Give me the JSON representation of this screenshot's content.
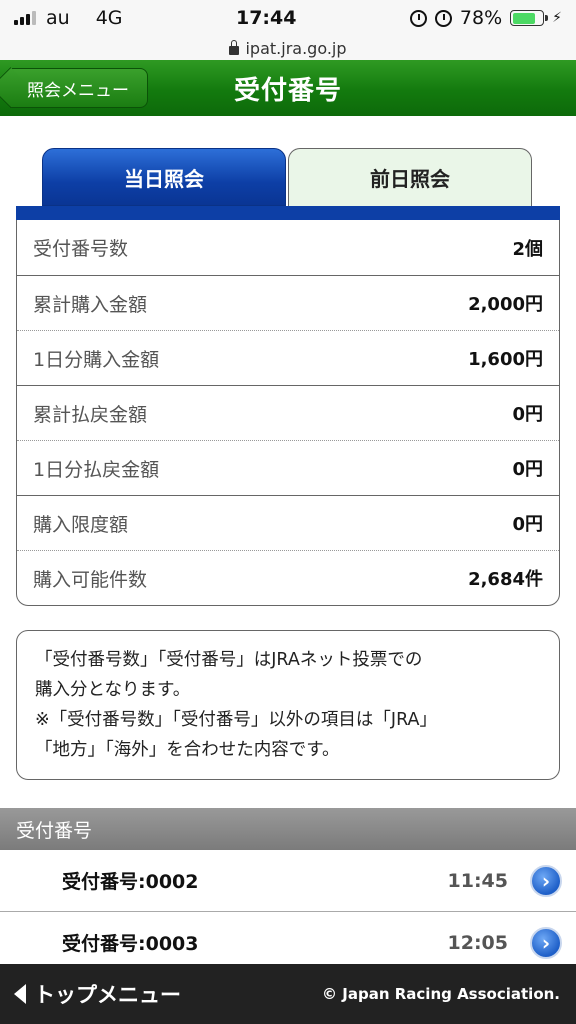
{
  "status_bar": {
    "carrier": "au",
    "network": "4G",
    "time": "17:44",
    "battery_percent": "78%",
    "battery_level": 0.78
  },
  "url": "ipat.jra.go.jp",
  "header": {
    "back_label": "照会メニュー",
    "title": "受付番号"
  },
  "tabs": [
    {
      "label": "当日照会",
      "active": true
    },
    {
      "label": "前日照会",
      "active": false
    }
  ],
  "summary": [
    {
      "label": "受付番号数",
      "value": "2個"
    },
    {
      "label": "累計購入金額",
      "value": "2,000円"
    },
    {
      "label": "1日分購入金額",
      "value": "1,600円"
    },
    {
      "label": "累計払戻金額",
      "value": "0円"
    },
    {
      "label": "1日分払戻金額",
      "value": "0円"
    },
    {
      "label": "購入限度額",
      "value": "0円"
    },
    {
      "label": "購入可能件数",
      "value": "2,684件"
    }
  ],
  "note": {
    "line1": "「受付番号数」「受付番号」はJRAネット投票での",
    "line2": "購入分となります。",
    "line3": "※「受付番号数」「受付番号」以外の項目は「JRA」",
    "line4": "「地方」「海外」を合わせた内容です。"
  },
  "section": {
    "title": "受付番号",
    "items": [
      {
        "label": "受付番号:0002",
        "time": "11:45"
      },
      {
        "label": "受付番号:0003",
        "time": "12:05"
      }
    ]
  },
  "footer": {
    "top_menu": "トップメニュー",
    "copyright": "© Japan Racing Association."
  },
  "colors": {
    "header_green": "#137a0e",
    "tab_blue": "#0d3fa6",
    "footer_bg": "#222222"
  }
}
